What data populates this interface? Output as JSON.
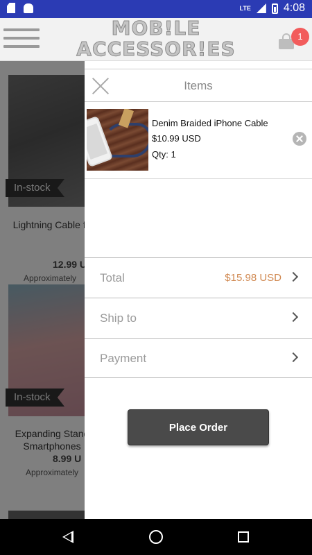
{
  "status_bar": {
    "time": "4:08",
    "network": "LTE",
    "icons": [
      "sd-card-icon",
      "android-icon",
      "signal-icon",
      "battery-icon"
    ]
  },
  "header": {
    "logo_line1": "MOB!LE",
    "logo_line2": "ACCESSOR!ES",
    "cart_count": "1",
    "icons": [
      "menu-icon",
      "shopping-bag-icon"
    ]
  },
  "products": [
    {
      "badge": "In-stock",
      "name": "Lightning Cable fo",
      "price": "12.99 U",
      "approx": "Approximately"
    },
    {
      "badge": "In-stock",
      "name": "Expanding Stand\nSmartphones",
      "price": "8.99 U",
      "approx": "Approximately"
    }
  ],
  "drawer": {
    "title": "Items",
    "items": [
      {
        "name": "Denim Braided iPhone Cable",
        "price": "$10.99 USD",
        "qty": "Qty: 1"
      }
    ],
    "total_label": "Total",
    "total_value": "$15.98 USD",
    "ship_label": "Ship to",
    "payment_label": "Payment",
    "place_order_label": "Place Order"
  },
  "colors": {
    "status_bar": "#2b3bb4",
    "badge": "#f25c5c",
    "total_value": "#d08850",
    "button": "#4a4a4a"
  }
}
